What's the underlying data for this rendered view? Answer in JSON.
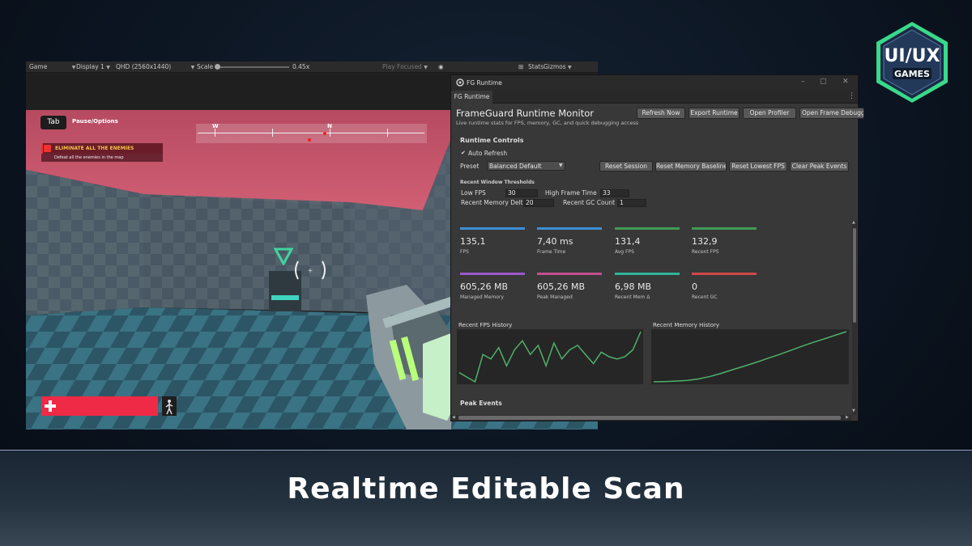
{
  "unity_toolbar": {
    "game_dropdown": "Game",
    "display_dropdown": "Display 1",
    "resolution_dropdown": "QHD (2560x1440)",
    "scale_label": "Scale",
    "scale_value": "0.45x",
    "play_focused": "Play Focused",
    "stats": "Stats",
    "gizmos": "Gizmos"
  },
  "hud": {
    "tab_key": "Tab",
    "pause_label": "Pause/Options",
    "objective_title": "ELIMINATE ALL THE ENEMIES",
    "objective_subtitle": "Defeat all the enemies in the map",
    "compass_west": "W",
    "compass_north": "N",
    "health_fraction": 1.0
  },
  "fg_window": {
    "title": "FG Runtime",
    "tab": "FG Runtime",
    "heading": "FrameGuard Runtime Monitor",
    "subtitle": "Live runtime stats for FPS, memory, GC, and quick debugging access",
    "buttons": {
      "refresh": "Refresh Now",
      "export": "Export Runtime",
      "profiler": "Open Profiler",
      "frame_debugger": "Open Frame Debugger"
    },
    "runtime_controls": {
      "title": "Runtime Controls",
      "auto_refresh": "Auto Refresh",
      "auto_refresh_checked": true,
      "preset_label": "Preset",
      "preset_value": "Balanced Default",
      "reset_session": "Reset Session",
      "reset_memory": "Reset Memory Baseline",
      "reset_fps": "Reset Lowest FPS",
      "clear_peak": "Clear Peak Events"
    },
    "thresholds": {
      "title": "Recent Window Thresholds",
      "low_fps_label": "Low FPS",
      "low_fps_value": "30",
      "high_frame_label": "High Frame Time",
      "high_frame_value": "33",
      "mem_delta_label": "Recent Memory Delta",
      "mem_delta_value": "20",
      "gc_count_label": "Recent GC Count",
      "gc_count_value": "1"
    },
    "metrics": [
      {
        "value": "135,1",
        "label": "FPS",
        "color": "#3d8fd6"
      },
      {
        "value": "7,40 ms",
        "label": "Frame Time",
        "color": "#3d8fd6"
      },
      {
        "value": "131,4",
        "label": "Avg FPS",
        "color": "#3f9a55"
      },
      {
        "value": "132,9",
        "label": "Recent FPS",
        "color": "#3f9a55"
      },
      {
        "value": "605,26 MB",
        "label": "Managed Memory",
        "color": "#9b59c9"
      },
      {
        "value": "605,26 MB",
        "label": "Peak Managed",
        "color": "#c0508c"
      },
      {
        "value": "6,98 MB",
        "label": "Recent Mem Δ",
        "color": "#2fb39a"
      },
      {
        "value": "0",
        "label": "Recent GC",
        "color": "#d04848"
      }
    ],
    "fps_history_label": "Recent FPS History",
    "memory_history_label": "Recent Memory History",
    "fps_history": [
      6,
      4,
      2,
      14,
      12,
      17,
      9,
      16,
      20,
      14,
      18,
      9,
      19,
      12,
      16,
      18,
      14,
      10,
      15,
      13,
      12,
      13,
      16,
      24
    ],
    "memory_history": [
      1,
      1.1,
      1.3,
      1.6,
      2.2,
      3.2,
      4.5,
      6,
      7.4,
      8.9,
      10.5,
      12,
      13.7,
      15.4,
      17,
      18.5,
      20,
      21.5
    ],
    "line_color": "#4fb06a",
    "peak_events_label": "Peak Events"
  },
  "logo": {
    "top": "UI/UX",
    "bottom": "GAMES",
    "accent": "#39d98a"
  },
  "caption": "Realtime Editable Scan"
}
